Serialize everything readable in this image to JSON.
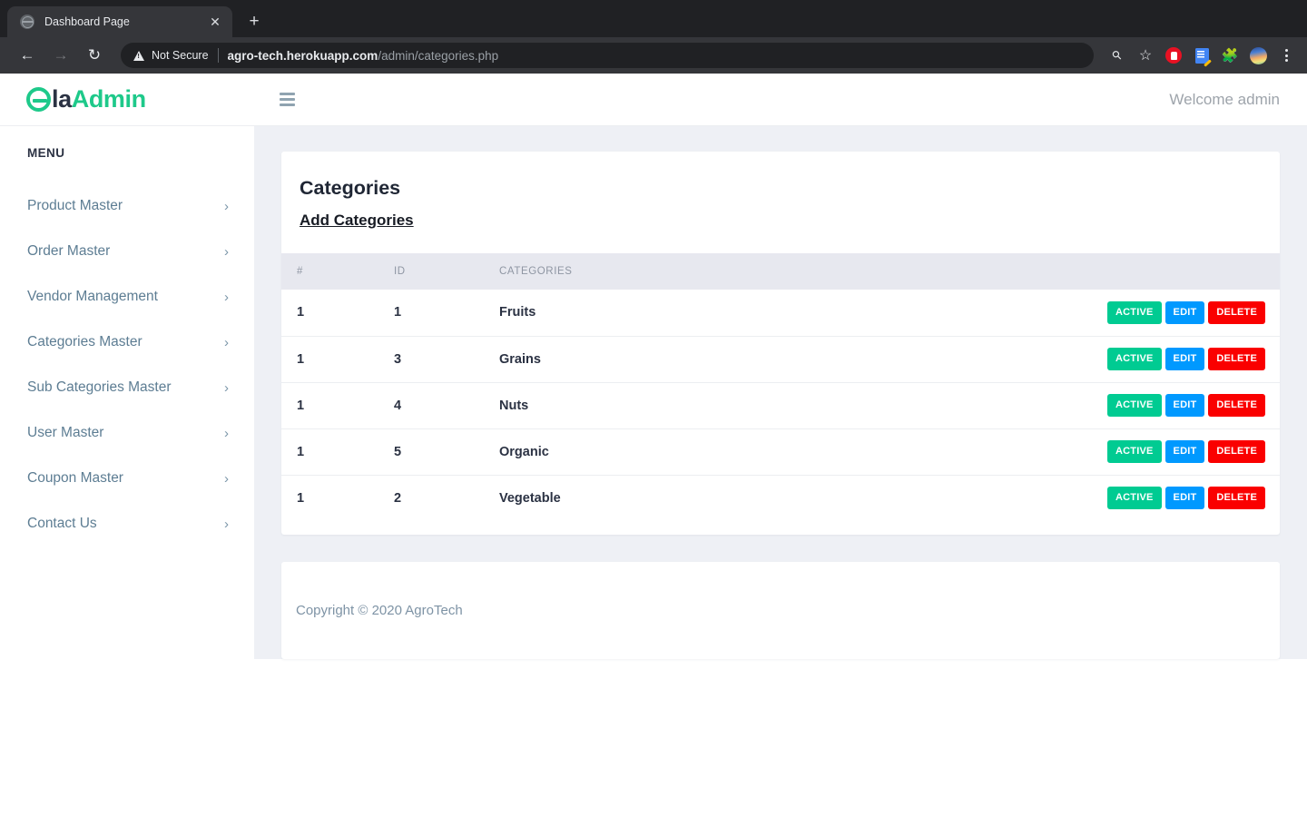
{
  "browser": {
    "tab": {
      "title": "Dashboard Page",
      "favicon": "globe-icon",
      "close_label": "✕"
    },
    "new_tab_label": "+",
    "nav": {
      "back_label": "←",
      "forward_label": "→",
      "reload_label": "↻"
    },
    "omnibox": {
      "security_label": "Not Secure",
      "url_host": "agro-tech.herokuapp.com",
      "url_path": "/admin/categories.php"
    },
    "toolbar_icons": [
      "password-key-icon",
      "bookmark-star-icon",
      "adblock-icon",
      "document-edit-icon",
      "extensions-puzzle-icon",
      "profile-avatar-icon",
      "chrome-menu-icon"
    ]
  },
  "app": {
    "brand": {
      "mark": "ela-logo-icon",
      "name_dark": "la",
      "name_accent": "Admin",
      "accent_color": "#1ec98a"
    },
    "menu_toggle": "hamburger-icon",
    "welcome": "Welcome admin"
  },
  "sidebar": {
    "heading": "MENU",
    "items": [
      {
        "label": "Product Master",
        "chevron": "›"
      },
      {
        "label": "Order Master",
        "chevron": "›"
      },
      {
        "label": "Vendor Management",
        "chevron": "›"
      },
      {
        "label": "Categories Master",
        "chevron": "›"
      },
      {
        "label": "Sub Categories Master",
        "chevron": "›"
      },
      {
        "label": "User Master",
        "chevron": "›"
      },
      {
        "label": "Coupon Master",
        "chevron": "›"
      },
      {
        "label": "Contact Us",
        "chevron": "›"
      }
    ]
  },
  "main": {
    "card_title": "Categories",
    "add_link": "Add Categories",
    "table": {
      "columns": [
        "#",
        "ID",
        "CATEGORIES",
        ""
      ],
      "rows": [
        {
          "num": "1",
          "id": "1",
          "category": "Fruits"
        },
        {
          "num": "1",
          "id": "3",
          "category": "Grains"
        },
        {
          "num": "1",
          "id": "4",
          "category": "Nuts"
        },
        {
          "num": "1",
          "id": "5",
          "category": "Organic"
        },
        {
          "num": "1",
          "id": "2",
          "category": "Vegetable"
        }
      ],
      "actions": {
        "active": "ACTIVE",
        "edit": "EDIT",
        "delete": "DELETE",
        "active_color": "#00cb92",
        "edit_color": "#0099ff",
        "delete_color": "#fa0000"
      }
    }
  },
  "footer": {
    "copyright": "Copyright © 2020 AgroTech"
  }
}
